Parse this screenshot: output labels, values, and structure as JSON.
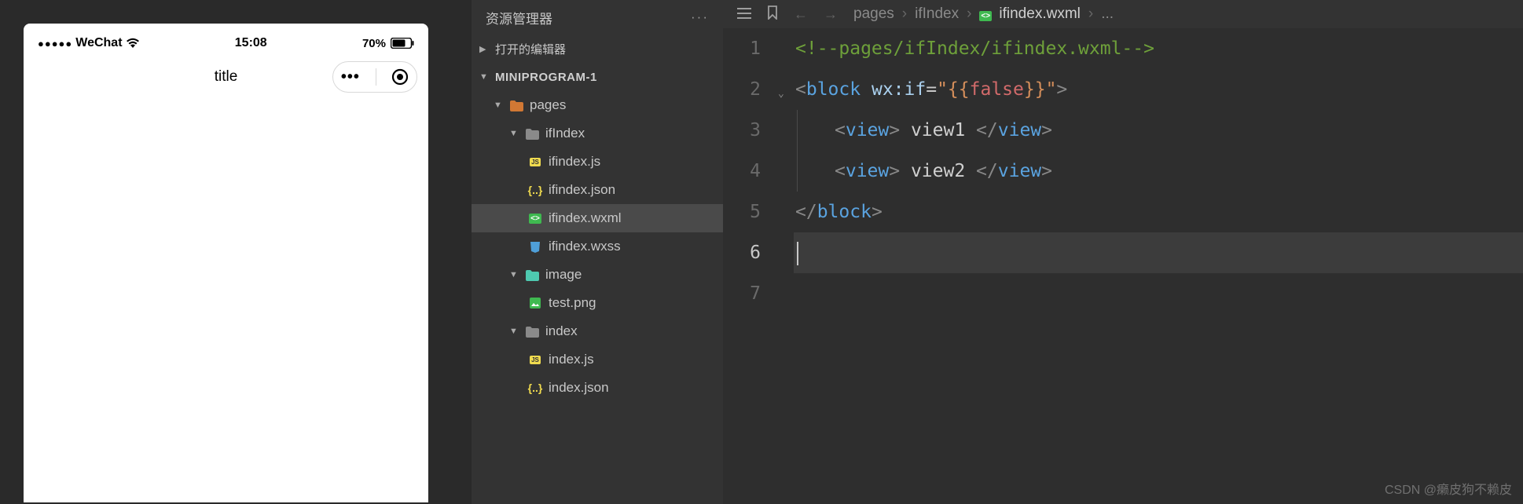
{
  "phone": {
    "carrier": "WeChat",
    "time": "15:08",
    "battery_pct": "70%",
    "nav_title": "title",
    "signal_dots": "●●●●●"
  },
  "explorer": {
    "title": "资源管理器",
    "sections": {
      "open_editors": "打开的编辑器",
      "project": "MINIPROGRAM-1"
    },
    "tree": {
      "pages": "pages",
      "ifIndex": "ifIndex",
      "ifindex_js": "ifindex.js",
      "ifindex_json": "ifindex.json",
      "ifindex_wxml": "ifindex.wxml",
      "ifindex_wxss": "ifindex.wxss",
      "image": "image",
      "test_png": "test.png",
      "index": "index",
      "index_js": "index.js",
      "index_json": "index.json"
    }
  },
  "breadcrumb": {
    "pages": "pages",
    "ifIndex": "ifIndex",
    "file": "ifindex.wxml",
    "more": "..."
  },
  "code": {
    "line_numbers": [
      "1",
      "2",
      "3",
      "4",
      "5",
      "6",
      "7"
    ],
    "comment": "<!--pages/ifIndex/ifindex.wxml-->",
    "block_open_tag": "block",
    "block_attr": "wx:if",
    "block_val_open": "\"{{",
    "block_val_kw": "false",
    "block_val_close": "}}\"",
    "view_tag": "view",
    "view1_text": " view1 ",
    "view2_text": " view2 ",
    "block_close": "block"
  },
  "watermark": "CSDN @癞皮狗不赖皮"
}
